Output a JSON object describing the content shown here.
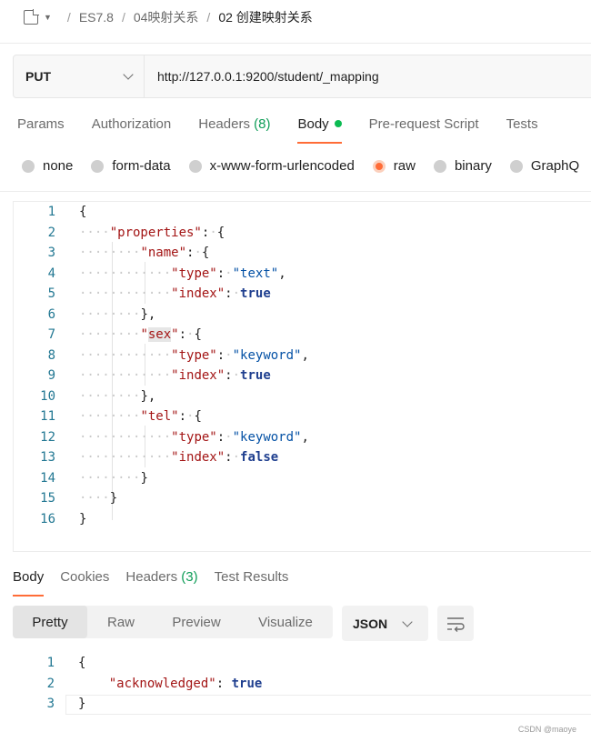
{
  "breadcrumb": {
    "items": [
      "ES7.8",
      "04映射关系"
    ],
    "separator": "/",
    "current": "02 创建映射关系"
  },
  "request": {
    "method": "PUT",
    "url": "http://127.0.0.1:9200/student/_mapping"
  },
  "request_tabs": [
    {
      "label": "Params"
    },
    {
      "label": "Authorization"
    },
    {
      "label": "Headers",
      "count": "(8)"
    },
    {
      "label": "Body",
      "active": true
    },
    {
      "label": "Pre-request Script"
    },
    {
      "label": "Tests"
    }
  ],
  "body_types": [
    {
      "label": "none"
    },
    {
      "label": "form-data"
    },
    {
      "label": "x-www-form-urlencoded"
    },
    {
      "label": "raw",
      "selected": true
    },
    {
      "label": "binary"
    },
    {
      "label": "GraphQ"
    }
  ],
  "editor": {
    "line_numbers": [
      "1",
      "2",
      "3",
      "4",
      "5",
      "6",
      "7",
      "8",
      "9",
      "10",
      "11",
      "12",
      "13",
      "14",
      "15",
      "16"
    ]
  },
  "response_tabs": [
    {
      "label": "Body",
      "active": true
    },
    {
      "label": "Cookies"
    },
    {
      "label": "Headers",
      "count": "(3)"
    },
    {
      "label": "Test Results"
    }
  ],
  "view_modes": [
    "Pretty",
    "Raw",
    "Preview",
    "Visualize"
  ],
  "view_mode_selected": "Pretty",
  "format": "JSON",
  "response": {
    "line_numbers": [
      "1",
      "2",
      "3"
    ],
    "key": "\"acknowledged\"",
    "value": "true"
  },
  "watermark": "CSDN @maoye",
  "colors": {
    "accent": "#ff6c37",
    "status_dot": "#0cbb52",
    "count": "#0f9d58",
    "json_key": "#a31515",
    "json_string": "#0451a5",
    "json_literal": "#1f3f8f"
  }
}
